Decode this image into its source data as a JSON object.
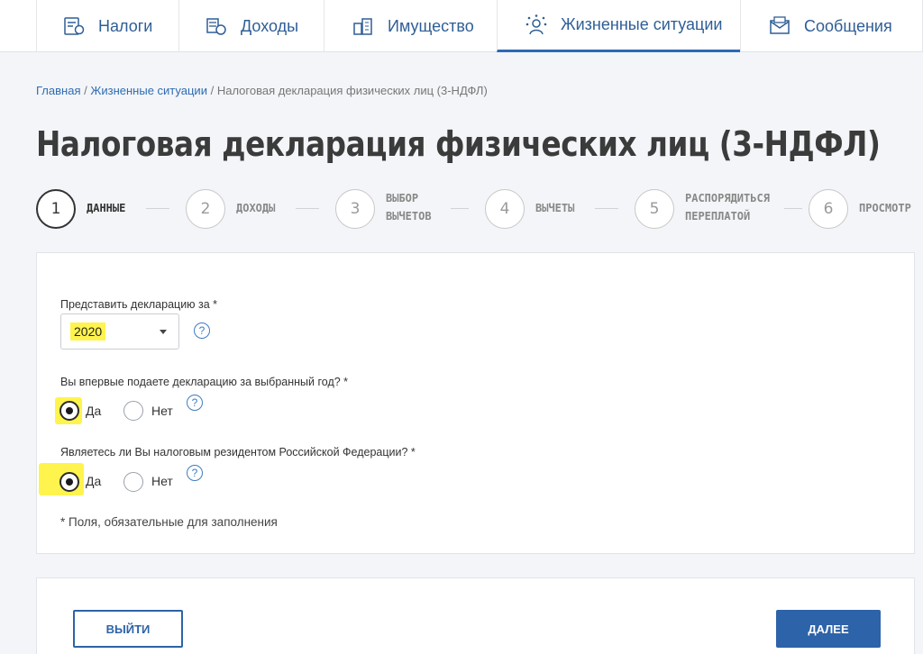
{
  "nav": {
    "tabs": [
      {
        "label": "Налоги",
        "icon": "calculator-doc-icon"
      },
      {
        "label": "Доходы",
        "icon": "coins-money-icon"
      },
      {
        "label": "Имущество",
        "icon": "buildings-icon"
      },
      {
        "label": "Жизненные ситуации",
        "icon": "person-situations-icon",
        "active": true
      },
      {
        "label": "Сообщения",
        "icon": "envelope-icon"
      }
    ]
  },
  "breadcrumb": {
    "home": "Главная",
    "section": "Жизненные ситуации",
    "current": "Налоговая декларация физических лиц (3-НДФЛ)",
    "sep": "/"
  },
  "title": "Налоговая декларация физических лиц (3-НДФЛ)",
  "stepper": [
    {
      "num": "1",
      "label_line1": "ДАННЫЕ",
      "label_line2": "",
      "active": true
    },
    {
      "num": "2",
      "label_line1": "ДОХОДЫ",
      "label_line2": ""
    },
    {
      "num": "3",
      "label_line1": "ВЫБОР",
      "label_line2": "ВЫЧЕТОВ"
    },
    {
      "num": "4",
      "label_line1": "ВЫЧЕТЫ",
      "label_line2": ""
    },
    {
      "num": "5",
      "label_line1": "РАСПОРЯДИТЬСЯ",
      "label_line2": "ПЕРЕПЛАТОЙ"
    },
    {
      "num": "6",
      "label_line1": "ПРОСМОТР",
      "label_line2": ""
    }
  ],
  "form": {
    "year_label": "Представить декларацию за *",
    "year_value": "2020",
    "first_time_label": "Вы впервые подаете декларацию за выбранный год? *",
    "resident_label": "Являетесь ли Вы налоговым резидентом Российской Федерации? *",
    "yes": "Да",
    "no": "Нет",
    "help": "?",
    "first_time_selected": "Да",
    "resident_selected": "Да",
    "required_note": "* Поля, обязательные для заполнения"
  },
  "buttons": {
    "exit": "ВЫЙТИ",
    "next": "ДАЛЕЕ"
  },
  "colors": {
    "accent": "#2d63a8",
    "highlight": "#fff34d",
    "background": "#f3f5f8"
  }
}
